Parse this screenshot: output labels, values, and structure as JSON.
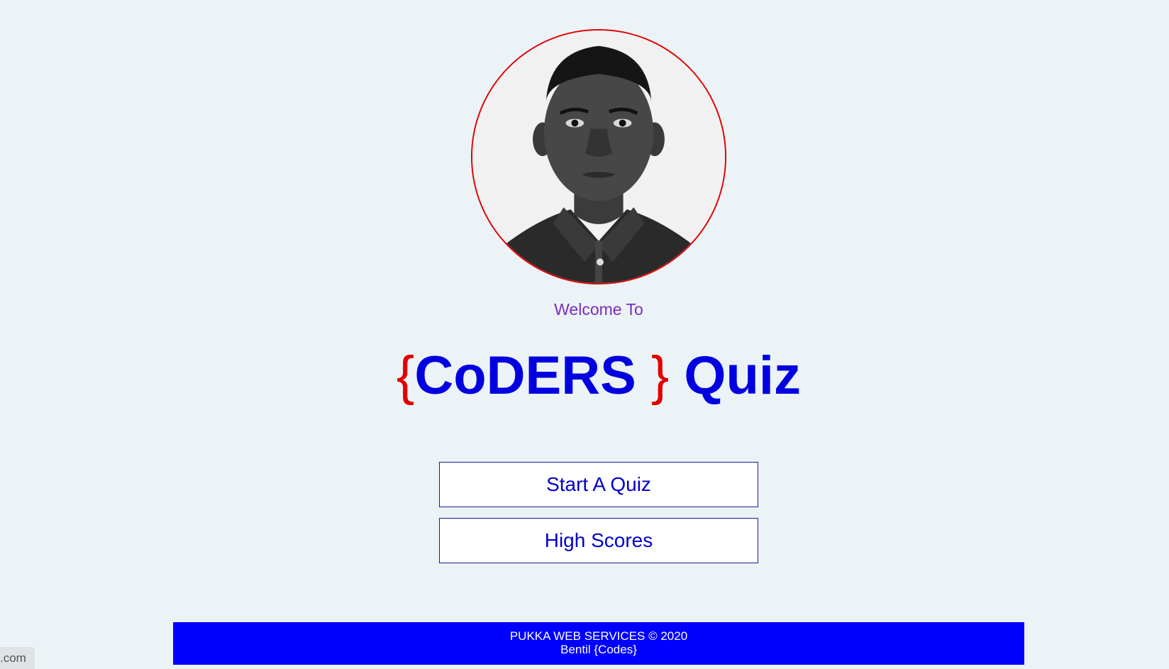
{
  "welcome_text": "Welcome To",
  "title": {
    "open_brace": "{",
    "name": "CoDERS",
    "close_brace": " }",
    "suffix": " Quiz"
  },
  "buttons": {
    "start": "Start A Quiz",
    "scores": "High Scores"
  },
  "footer": {
    "line1": "PUKKA WEB SERVICES © 2020",
    "line2": "Bentil {Codes}"
  },
  "status_bar": {
    "url_fragment": ".com"
  },
  "colors": {
    "background": "#ecf3f6",
    "accent_red": "#e00000",
    "brand_blue": "#0000e0",
    "welcome_purple": "#7b2cbf",
    "footer_blue": "#0000ff"
  }
}
